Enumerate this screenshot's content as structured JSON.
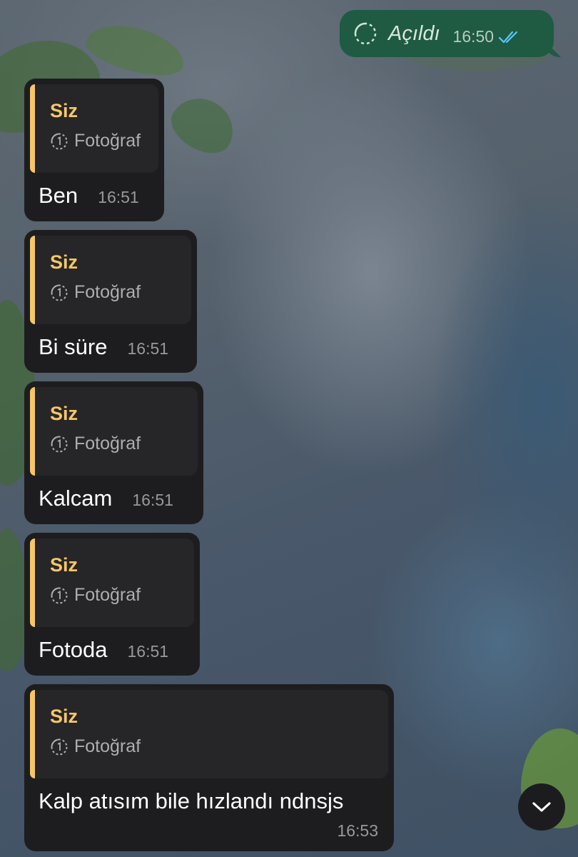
{
  "sent_message": {
    "text": "Açıldı",
    "time": "16:50",
    "status_icon": "double-check-icon",
    "type_icon": "view-once-icon"
  },
  "received_messages": [
    {
      "quote_author": "Siz",
      "quote_type": "Fotoğraf",
      "quote_icon": "view-once-icon",
      "text": "Ben",
      "time": "16:51"
    },
    {
      "quote_author": "Siz",
      "quote_type": "Fotoğraf",
      "quote_icon": "view-once-icon",
      "text": "Bi süre",
      "time": "16:51"
    },
    {
      "quote_author": "Siz",
      "quote_type": "Fotoğraf",
      "quote_icon": "view-once-icon",
      "text": "Kalcam",
      "time": "16:51"
    },
    {
      "quote_author": "Siz",
      "quote_type": "Fotoğraf",
      "quote_icon": "view-once-icon",
      "text": "Fotoda",
      "time": "16:51"
    },
    {
      "quote_author": "Siz",
      "quote_type": "Fotoğraf",
      "quote_icon": "view-once-icon",
      "text": "Kalp atısım bile hızlandı ndnsjs",
      "time": "16:53"
    }
  ],
  "scroll_down_icon": "chevron-down-icon",
  "colors": {
    "sent_bubble": "#1f5a43",
    "received_bubble": "#1d1d1f",
    "quote_accent": "#f7c668",
    "ticks": "#5ac8fa"
  }
}
